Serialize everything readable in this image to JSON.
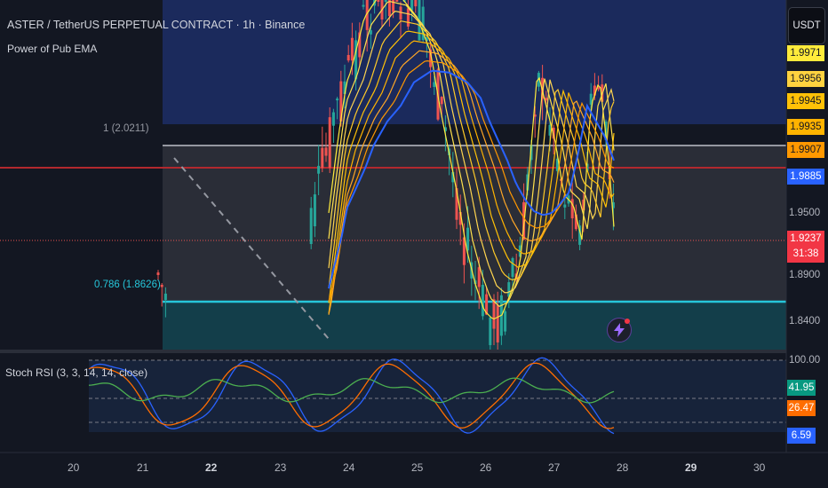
{
  "header": {
    "title": "ASTER / TetherUS PERPETUAL CONTRACT · 1h · Binance",
    "indicator": "Power of Pub EMA"
  },
  "currency": "USDT",
  "price_axis": {
    "ema_tags": [
      {
        "label": "1.9971",
        "bg": "#ffeb3b",
        "fg": "#131722"
      },
      {
        "label": "1.9956",
        "bg": "#ffd23f",
        "fg": "#131722"
      },
      {
        "label": "1.9945",
        "bg": "#ffc107",
        "fg": "#131722"
      },
      {
        "label": "1.9935",
        "bg": "#ffb300",
        "fg": "#131722"
      },
      {
        "label": "1.9907",
        "bg": "#ff9800",
        "fg": "#131722"
      },
      {
        "label": "1.9885",
        "bg": "#2962ff",
        "fg": "#ffffff"
      }
    ],
    "plain_labels": [
      "1.9500",
      "1.8900",
      "1.8400"
    ],
    "current_price": "1.9237",
    "countdown": "31:38"
  },
  "fib_levels": [
    {
      "label": "1 (2.0211)",
      "color": "#9598a1"
    },
    {
      "label": "0.786 (1.8626)",
      "color": "#26c6da"
    }
  ],
  "stoch_rsi": {
    "label": "Stoch RSI (3, 3, 14, 14, close)",
    "axis_top": "100.00",
    "tags": [
      {
        "label": "41.95",
        "bg": "#089981",
        "fg": "#ffffff"
      },
      {
        "label": "26.47",
        "bg": "#ff6d00",
        "fg": "#ffffff"
      },
      {
        "label": "6.59",
        "bg": "#2962ff",
        "fg": "#ffffff"
      }
    ]
  },
  "time_axis": [
    {
      "label": "20",
      "bold": false
    },
    {
      "label": "21",
      "bold": false
    },
    {
      "label": "22",
      "bold": true
    },
    {
      "label": "23",
      "bold": false
    },
    {
      "label": "24",
      "bold": false
    },
    {
      "label": "25",
      "bold": false
    },
    {
      "label": "26",
      "bold": false
    },
    {
      "label": "27",
      "bold": false
    },
    {
      "label": "28",
      "bold": false
    },
    {
      "label": "29",
      "bold": true
    },
    {
      "label": "30",
      "bold": false
    }
  ],
  "colors": {
    "background": "#131722",
    "up": "#26a69a",
    "down": "#ef5350",
    "ema_slow": "#2962ff",
    "stoch_k": "#2962ff",
    "stoch_d": "#ff6d00",
    "rsi_line": "#4caf50"
  },
  "chart_data": {
    "type": "candlestick",
    "symbol": "ASTER / TetherUS",
    "interval": "1h",
    "price_levels_shown": [
      1.9971,
      1.9956,
      1.9945,
      1.9935,
      1.9907,
      1.9885,
      1.95,
      1.9237,
      1.89,
      1.84
    ],
    "fib_retracement": [
      {
        "level": 1,
        "price": 2.0211
      },
      {
        "level": 0.786,
        "price": 1.8626
      }
    ],
    "last_price": 1.9237,
    "stoch_rsi_values": {
      "rsi": 41.95,
      "d": 26.47,
      "k": 6.59
    }
  }
}
